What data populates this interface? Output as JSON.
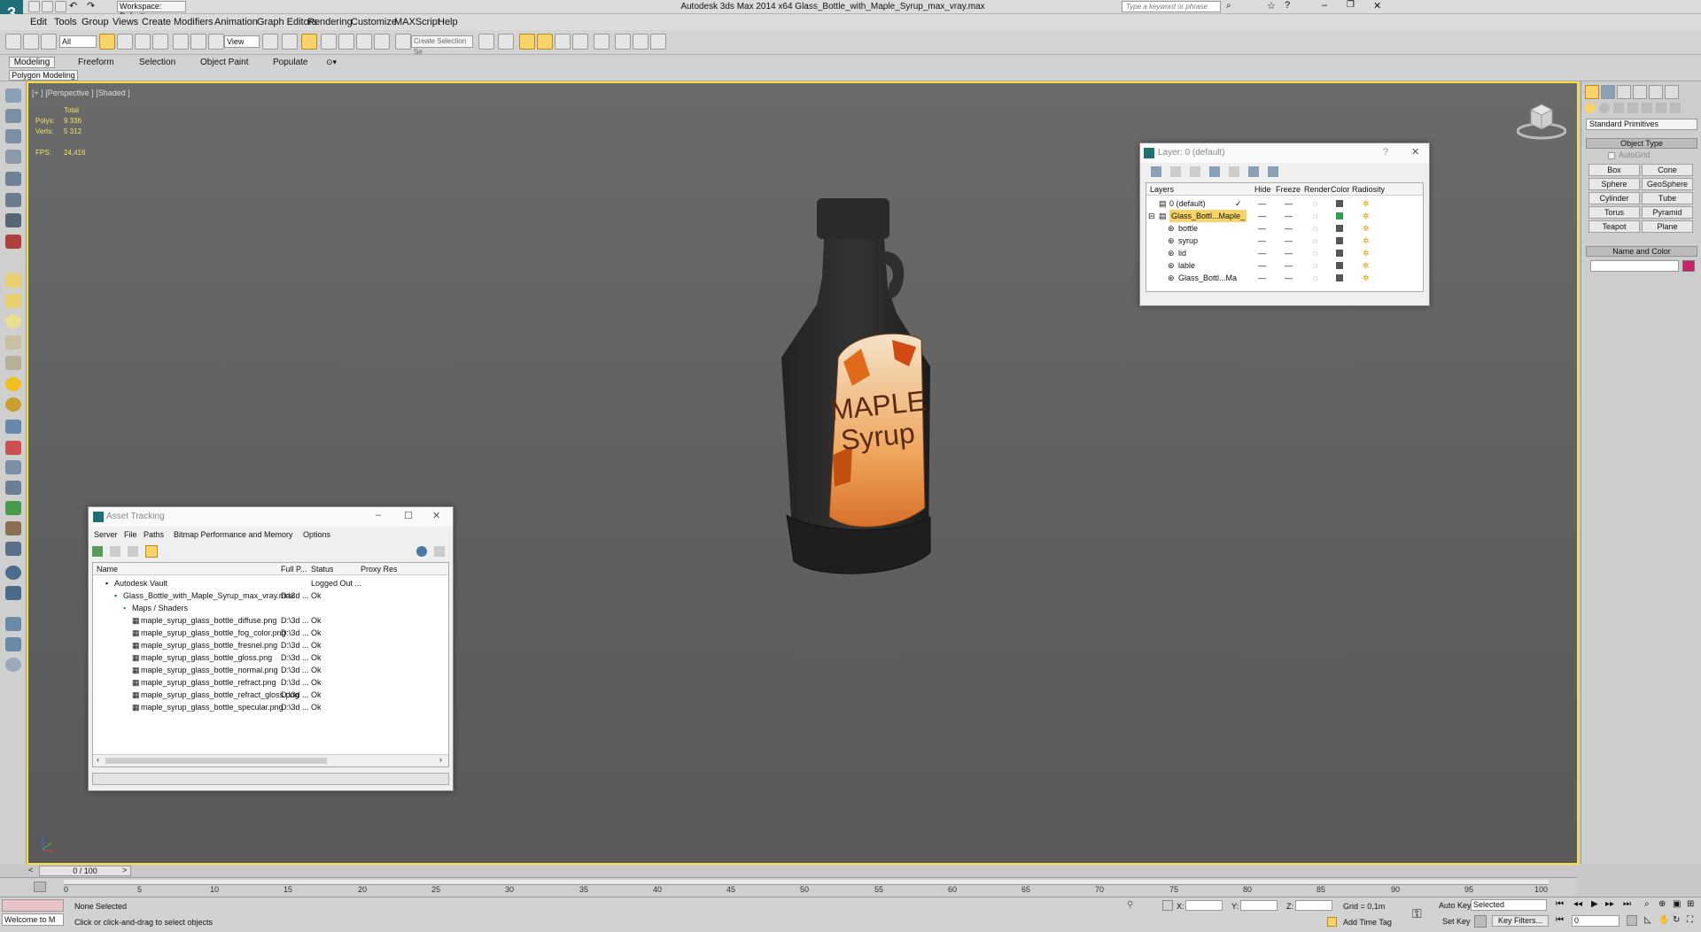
{
  "app": {
    "title": "Autodesk 3ds Max  2014 x64     Glass_Bottle_with_Maple_Syrup_max_vray.max",
    "workspace": "Workspace: Default",
    "search_placeholder": "Type a keyword or phrase"
  },
  "menu": [
    "Edit",
    "Tools",
    "Group",
    "Views",
    "Create",
    "Modifiers",
    "Animation",
    "Graph Editors",
    "Rendering",
    "Customize",
    "MAXScript",
    "Help"
  ],
  "toolbar": {
    "filter": "All",
    "ref_coord": "View",
    "selection_set": "Create Selection Se"
  },
  "ribbon": {
    "tabs": [
      "Modeling",
      "Freeform",
      "Selection",
      "Object Paint",
      "Populate"
    ],
    "sub": "Polygon Modeling"
  },
  "viewport": {
    "label": "[+ ] [Perspective ] [Shaded ]",
    "stats": {
      "total": "Total",
      "polys_label": "Polys:",
      "polys": "9 336",
      "verts_label": "Verts:",
      "verts": "5 312",
      "fps_label": "FPS:",
      "fps": "24,416"
    },
    "label_line1": "MAPLE",
    "label_line2": "Syrup"
  },
  "layer_dialog": {
    "title": "Layer: 0 (default)",
    "headers": [
      "Layers",
      "Hide",
      "Freeze",
      "Render",
      "Color",
      "Radiosity"
    ],
    "rows": [
      {
        "name": "0 (default)",
        "color": "#555555"
      },
      {
        "name": "Glass_Bottl...Maple_",
        "color": "#2aa24a"
      },
      {
        "name": "bottle",
        "color": "#555555"
      },
      {
        "name": "syrup",
        "color": "#555555"
      },
      {
        "name": "lid",
        "color": "#555555"
      },
      {
        "name": "lable",
        "color": "#555555"
      },
      {
        "name": "Glass_Bottl...Ma",
        "color": "#555555"
      }
    ]
  },
  "asset_tracking": {
    "title": "Asset Tracking",
    "menu": [
      "Server",
      "File",
      "Paths",
      "Bitmap Performance and Memory",
      "Options"
    ],
    "headers": [
      "Name",
      "Full P...",
      "Status",
      "Proxy Res"
    ],
    "rows": [
      {
        "name": "Autodesk Vault",
        "path": "",
        "status": "Logged Out ..."
      },
      {
        "name": "Glass_Bottle_with_Maple_Syrup_max_vray.max",
        "path": "D:\\3d ...",
        "status": "Ok"
      },
      {
        "name": "Maps / Shaders",
        "path": "",
        "status": ""
      },
      {
        "name": "maple_syrup_glass_bottle_diffuse.png",
        "path": "D:\\3d ...",
        "status": "Ok"
      },
      {
        "name": "maple_syrup_glass_bottle_fog_color.png",
        "path": "D:\\3d ...",
        "status": "Ok"
      },
      {
        "name": "maple_syrup_glass_bottle_fresnel.png",
        "path": "D:\\3d ...",
        "status": "Ok"
      },
      {
        "name": "maple_syrup_glass_bottle_gloss.png",
        "path": "D:\\3d ...",
        "status": "Ok"
      },
      {
        "name": "maple_syrup_glass_bottle_normal.png",
        "path": "D:\\3d ...",
        "status": "Ok"
      },
      {
        "name": "maple_syrup_glass_bottle_refract.png",
        "path": "D:\\3d ...",
        "status": "Ok"
      },
      {
        "name": "maple_syrup_glass_bottle_refract_gloss.png",
        "path": "D:\\3d ...",
        "status": "Ok"
      },
      {
        "name": "maple_syrup_glass_bottle_specular.png",
        "path": "D:\\3d ...",
        "status": "Ok"
      }
    ]
  },
  "command_panel": {
    "category": "Standard Primitives",
    "object_type": "Object Type",
    "autogrid": "AutoGrid",
    "buttons": [
      "Box",
      "Cone",
      "Sphere",
      "GeoSphere",
      "Cylinder",
      "Tube",
      "Torus",
      "Pyramid",
      "Teapot",
      "Plane"
    ],
    "name_color": "Name and Color",
    "swatch": "#c8246e"
  },
  "timeline": {
    "frame": "0 / 100",
    "ticks": [
      "0",
      "5",
      "10",
      "15",
      "20",
      "25",
      "30",
      "35",
      "40",
      "45",
      "50",
      "55",
      "60",
      "65",
      "70",
      "75",
      "80",
      "85",
      "90",
      "95",
      "100"
    ]
  },
  "status": {
    "maxscript": "Welcome to M",
    "selection": "None Selected",
    "prompt": "Click or click-and-drag to select objects",
    "x": "X:",
    "y": "Y:",
    "z": "Z:",
    "grid": "Grid = 0,1m",
    "add_time_tag": "Add Time Tag",
    "auto_key": "Auto Key",
    "set_key": "Set Key",
    "selected": "Selected",
    "key_filters": "Key Filters...",
    "frame_field": "0"
  }
}
